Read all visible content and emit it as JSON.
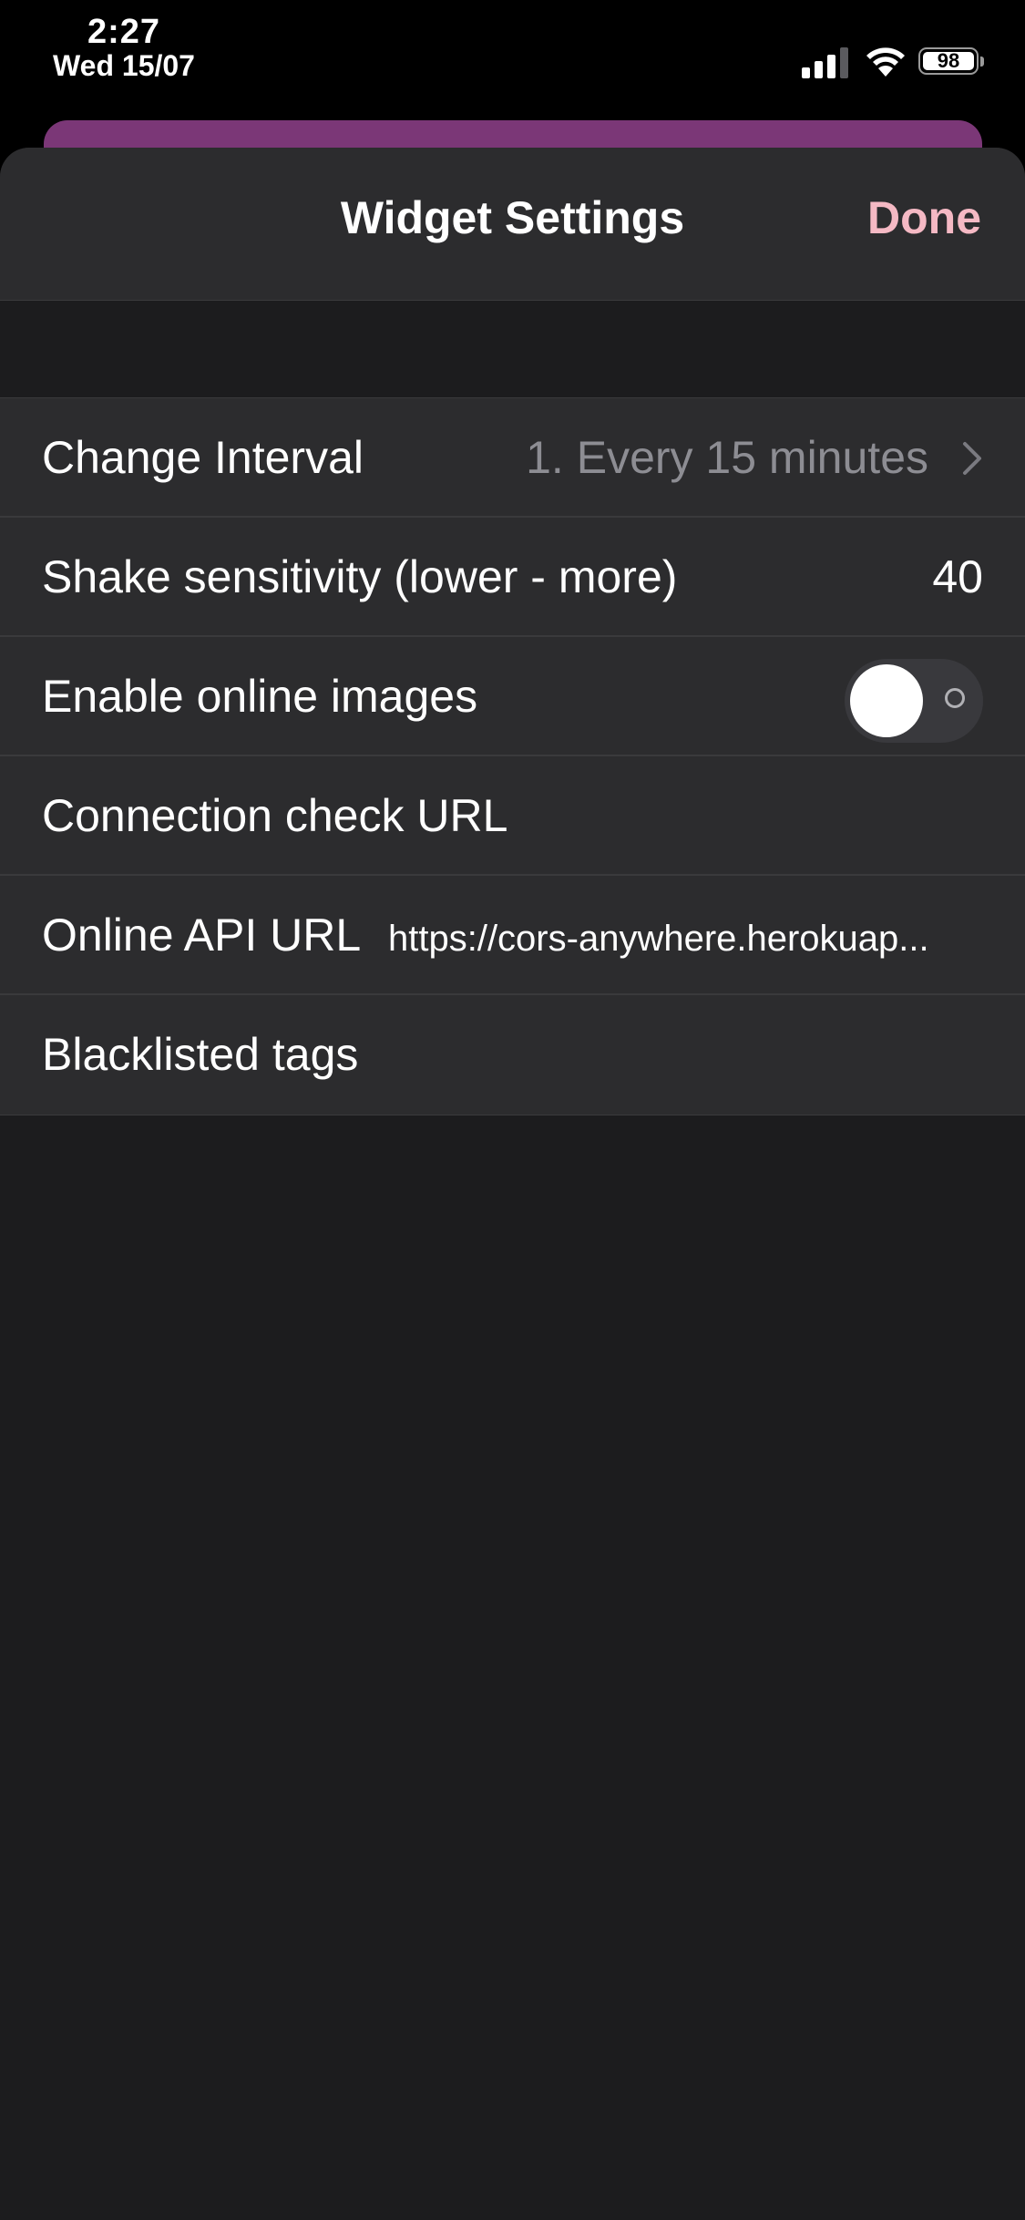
{
  "status_bar": {
    "time": "2:27",
    "date": "Wed 15/07",
    "battery": "98",
    "signal_icon": "cellular-signal-icon",
    "wifi_icon": "wifi-icon"
  },
  "sheet": {
    "title": "Widget Settings",
    "done_label": "Done"
  },
  "settings": {
    "change_interval": {
      "label": "Change Interval",
      "value": "1. Every 15 minutes"
    },
    "shake_sensitivity": {
      "label": "Shake sensitivity (lower - more)",
      "value": "40"
    },
    "online_images": {
      "label": "Enable online images",
      "enabled": false
    },
    "connection_check": {
      "label": "Connection check URL",
      "value": ""
    },
    "online_api": {
      "label": "Online API URL",
      "value": "https://cors-anywhere.herokuap..."
    },
    "blacklisted_tags": {
      "label": "Blacklisted tags"
    }
  },
  "colors": {
    "accent": "#f5b9c4",
    "sheet_background": "#1c1c1e",
    "row_background": "#2c2c2e",
    "underlay_card": "#7b3777"
  }
}
